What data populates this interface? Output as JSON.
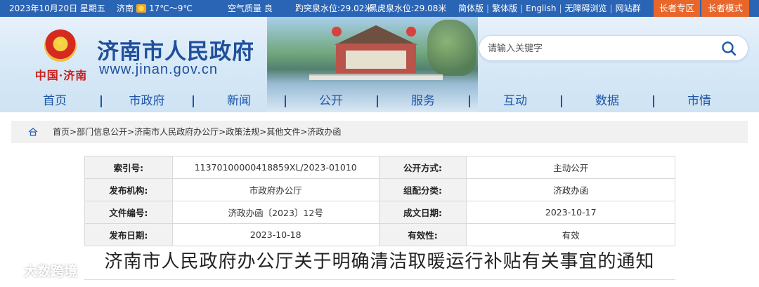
{
  "topbar": {
    "date": "2023年10月20日 星期五",
    "city": "济南",
    "weather_icon": "sun-icon",
    "temperature": "17℃～9℃",
    "air_quality": "空气质量 良",
    "spring_level_1": "趵突泉水位:29.02米",
    "spring_level_2": "黑虎泉水位:29.08米",
    "lang_links": [
      "简体版",
      "繁体版",
      "English",
      "无障碍浏览",
      "网站群"
    ],
    "separator": "|",
    "elder_zone": "长者专区",
    "elder_mode": "长者模式"
  },
  "header": {
    "logo_text": "中国·济南",
    "site_title": "济南市人民政府",
    "site_url": "www.jinan.gov.cn",
    "search_placeholder": "请输入关键字"
  },
  "nav": {
    "items": [
      "首页",
      "市政府",
      "新闻",
      "公开",
      "服务",
      "互动",
      "数据",
      "市情"
    ]
  },
  "breadcrumb": {
    "items": [
      "首页",
      "部门信息公开",
      "济南市人民政府办公厅",
      "政策法规",
      "其他文件",
      "济政办函"
    ],
    "separator": ">"
  },
  "meta": {
    "index_label": "索引号:",
    "index_value": "11370100000418859XL/2023-01010",
    "method_label": "公开方式:",
    "method_value": "主动公开",
    "org_label": "发布机构:",
    "org_value": "市政府办公厅",
    "category_label": "组配分类:",
    "category_value": "济政办函",
    "docno_label": "文件编号:",
    "docno_value": "济政办函〔2023〕12号",
    "created_label": "成文日期:",
    "created_value": "2023-10-17",
    "publish_label": "发布日期:",
    "publish_value": "2023-10-18",
    "validity_label": "有效性:",
    "validity_value": "有效"
  },
  "document": {
    "title": "济南市人民政府办公厅关于明确清洁取暖运行补贴有关事宜的通知"
  },
  "watermark": {
    "text": "大数跨境"
  },
  "colors": {
    "topbar_bg": "#2a64b4",
    "elder_button_bg": "#e8662a",
    "brand_blue": "#1f4f9c",
    "nav_blue": "#1e56a8"
  }
}
